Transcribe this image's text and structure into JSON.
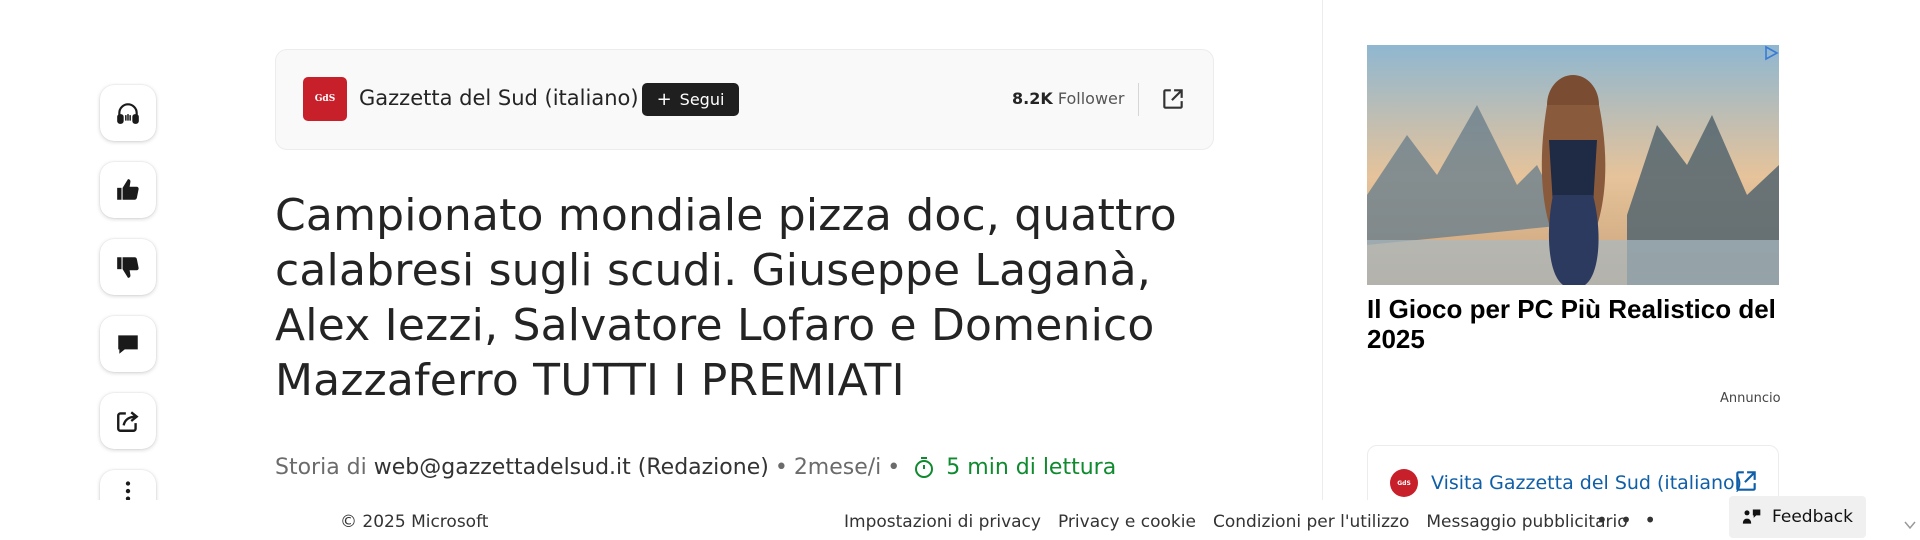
{
  "rail": {
    "items": [
      {
        "name": "listen",
        "icon": "headphones-icon"
      },
      {
        "name": "like",
        "icon": "thumbs-up-icon"
      },
      {
        "name": "dislike",
        "icon": "thumbs-down-icon"
      },
      {
        "name": "comment",
        "icon": "comment-icon"
      },
      {
        "name": "share",
        "icon": "share-icon"
      },
      {
        "name": "more",
        "icon": "more-vertical-icon"
      }
    ]
  },
  "publisher": {
    "logo_text": "GdS",
    "name": "Gazzetta del Sud (italiano)",
    "follow_label": "Segui",
    "follower_count": "8.2K",
    "follower_label": "Follower",
    "brand_color": "#c8202a"
  },
  "article": {
    "headline": "Campionato mondiale pizza doc, quattro calabresi sugli scudi. Giuseppe Laganà, Alex Iezzi, Salvatore Lofaro e Domenico Mazzaferro TUTTI I PREMIATI",
    "byline_prefix": "Storia di",
    "author": "web@gazzettadelsud.it (Redazione)",
    "separator": "•",
    "age": "2mese/i",
    "read_time": "5 min di lettura",
    "read_color": "#0f8a2e"
  },
  "ad": {
    "title": "Il Gioco per PC Più Realistico del 2025",
    "label": "Annuncio"
  },
  "visit": {
    "logo_text": "GdS",
    "label": "Visita Gazzetta del Sud (italiano)"
  },
  "footer": {
    "copyright": "© 2025 Microsoft",
    "links": [
      "Impostazioni di privacy",
      "Privacy e cookie",
      "Condizioni per l'utilizzo",
      "Messaggio pubblicitario"
    ],
    "more": "• • •",
    "feedback_label": "Feedback"
  }
}
